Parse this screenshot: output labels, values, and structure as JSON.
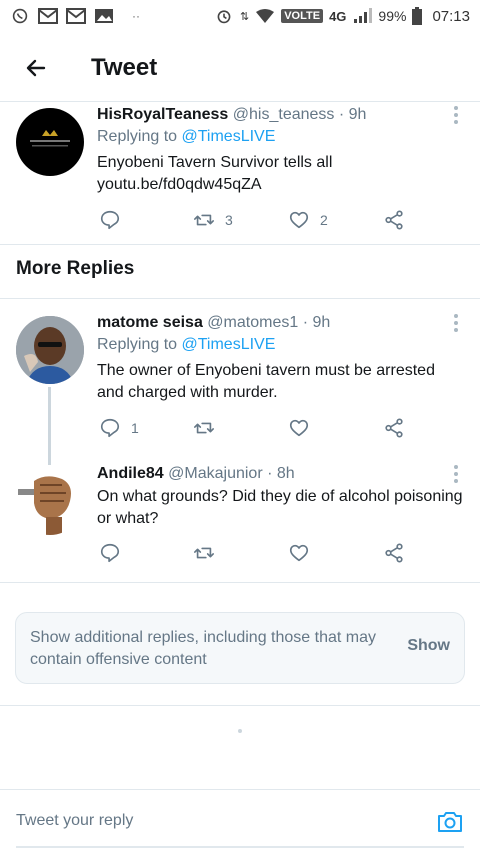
{
  "status_bar": {
    "network_badge": "VOLTE",
    "network_type": "4G",
    "battery": "99%",
    "time": "07:13"
  },
  "header": {
    "title": "Tweet",
    "back_icon": "arrow-left-icon"
  },
  "tweets": [
    {
      "name": "HisRoyalTeaness",
      "handle": "@his_teaness",
      "time": "· 9h",
      "replying_label": "Replying to ",
      "replying_to": "@TimesLIVE",
      "text": "Enyobeni Tavern Survivor tells all",
      "link": "youtu.be/fd0qdw45qZA",
      "reply_count": "",
      "retweet_count": "3",
      "like_count": "2"
    },
    {
      "name": "matome seisa",
      "handle": "@matomes1",
      "time": "· 9h",
      "replying_label": "Replying to ",
      "replying_to": "@TimesLIVE",
      "text": "The owner of Enyobeni tavern must be arrested and charged with murder.",
      "reply_count": "1",
      "retweet_count": "",
      "like_count": ""
    },
    {
      "name": "Andile84",
      "handle": "@Makajunior",
      "time": "· 8h",
      "text": "On what grounds? Did they die of alcohol poisoning or what?",
      "reply_count": "",
      "retweet_count": "",
      "like_count": ""
    }
  ],
  "section_title": "More Replies",
  "notice": {
    "text": "Show additional replies, including those that may contain offensive content",
    "button": "Show"
  },
  "composer": {
    "placeholder": "Tweet your reply",
    "camera_icon": "camera-icon"
  },
  "colors": {
    "link": "#1da1f2",
    "secondary_text": "#657786",
    "divider": "#e1e8ed"
  }
}
